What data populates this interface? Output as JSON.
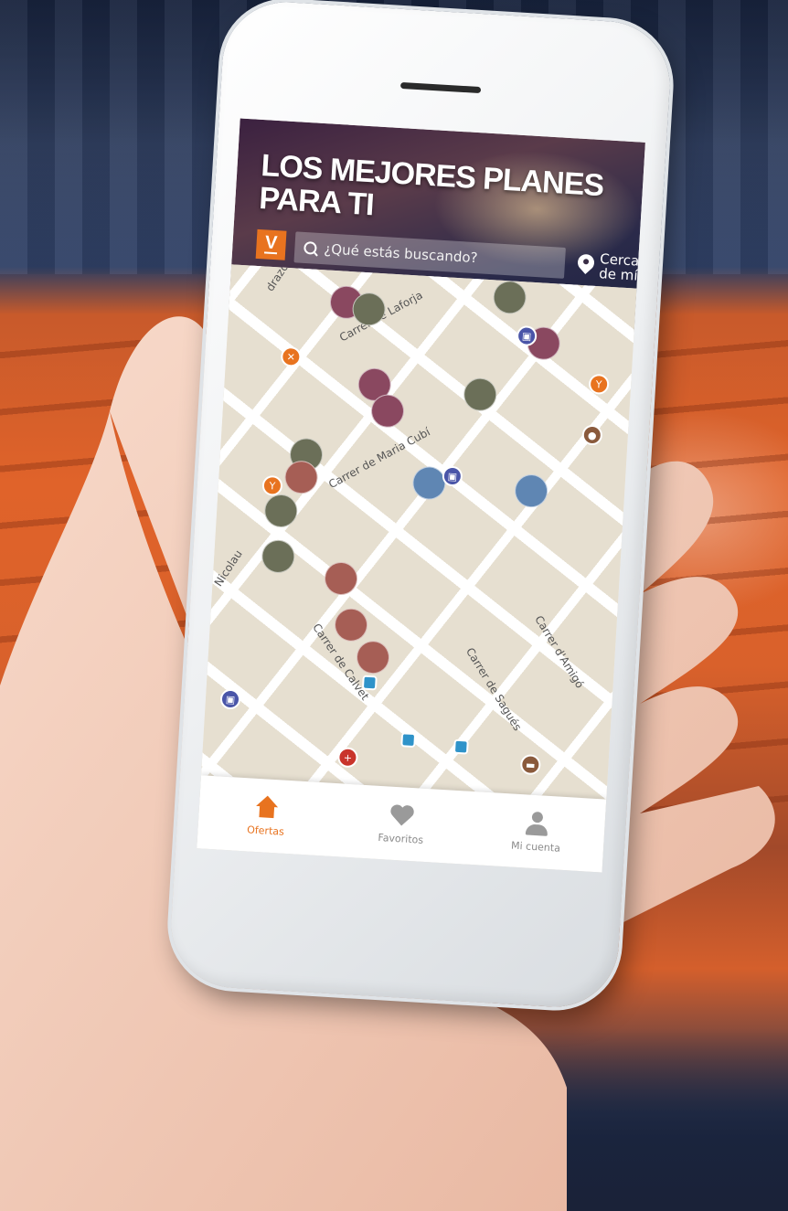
{
  "header": {
    "headline": "LOS MEJORES PLANES PARA TI",
    "logo_letter": "V",
    "search_placeholder": "¿Qué estás buscando?",
    "nearby_line1": "Cerca",
    "nearby_line2": "de mí"
  },
  "map": {
    "street_labels": [
      "Carrer de Laforja",
      "Carrer de Maria Cubí",
      "Nicolau",
      "Carrer de Calvet",
      "Carrer de Sagués",
      "Carrer d'Amigó",
      "drazo"
    ]
  },
  "nav": {
    "items": [
      {
        "label": "Ofertas",
        "icon": "home-icon",
        "active": true
      },
      {
        "label": "Favoritos",
        "icon": "heart-icon",
        "active": false
      },
      {
        "label": "Mi cuenta",
        "icon": "user-icon",
        "active": false
      }
    ]
  },
  "colors": {
    "accent": "#e8731f",
    "marker_olive": "#6b6f58",
    "marker_plum": "#8a4860",
    "marker_rose": "#a65e55",
    "marker_blue": "#5f86b3"
  }
}
